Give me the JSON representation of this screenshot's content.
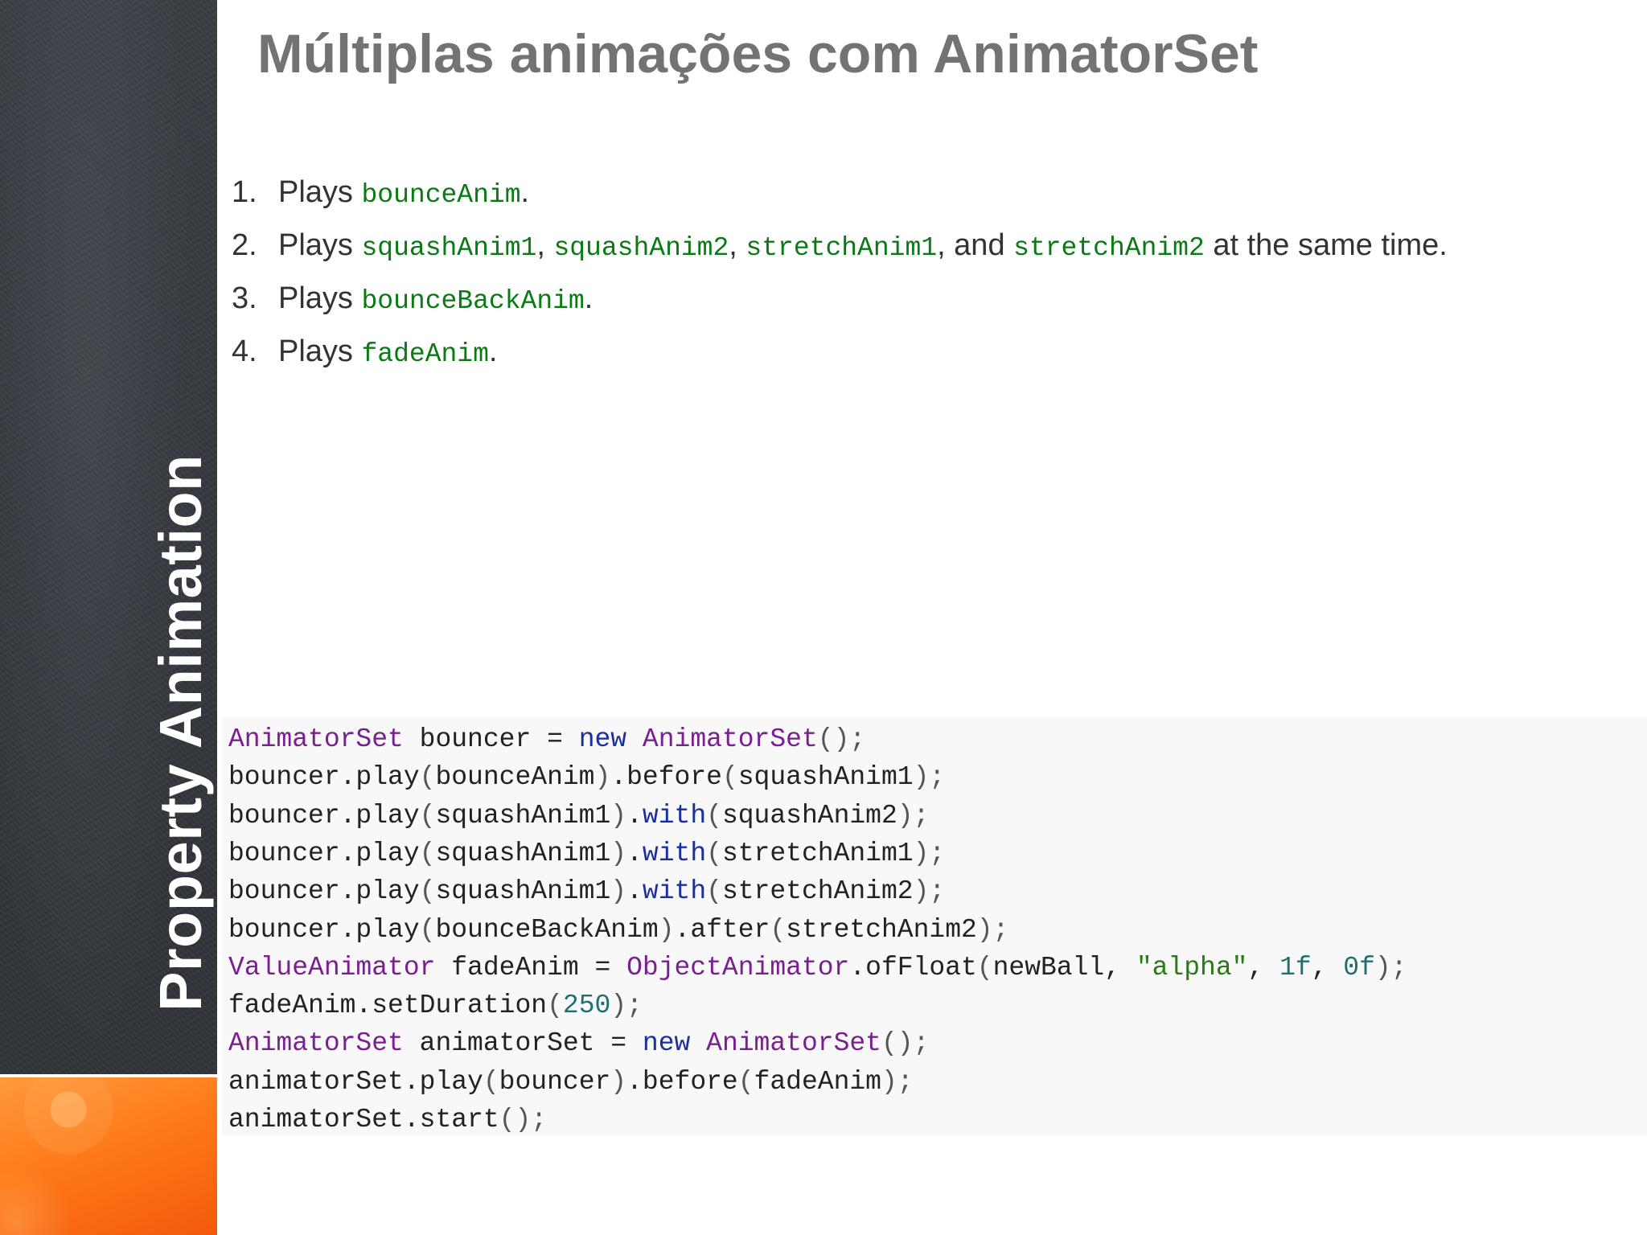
{
  "sidebar": {
    "vertical_title": "Property Animation"
  },
  "slide": {
    "title": "Múltiplas animações com AnimatorSet"
  },
  "steps": [
    {
      "num": "1.",
      "parts": [
        {
          "t": "text",
          "v": "Plays "
        },
        {
          "t": "code",
          "v": "bounceAnim"
        },
        {
          "t": "text",
          "v": "."
        }
      ]
    },
    {
      "num": "2.",
      "parts": [
        {
          "t": "text",
          "v": "Plays "
        },
        {
          "t": "code",
          "v": "squashAnim1"
        },
        {
          "t": "text",
          "v": ", "
        },
        {
          "t": "code",
          "v": "squashAnim2"
        },
        {
          "t": "text",
          "v": ", "
        },
        {
          "t": "code",
          "v": "stretchAnim1"
        },
        {
          "t": "text",
          "v": ", and "
        },
        {
          "t": "code",
          "v": "stretchAnim2"
        },
        {
          "t": "text",
          "v": " at the same time."
        }
      ]
    },
    {
      "num": "3.",
      "parts": [
        {
          "t": "text",
          "v": "Plays "
        },
        {
          "t": "code",
          "v": "bounceBackAnim"
        },
        {
          "t": "text",
          "v": "."
        }
      ]
    },
    {
      "num": "4.",
      "parts": [
        {
          "t": "text",
          "v": "Plays "
        },
        {
          "t": "code",
          "v": "fadeAnim"
        },
        {
          "t": "text",
          "v": "."
        }
      ]
    }
  ],
  "code": [
    [
      {
        "c": "type",
        "v": "AnimatorSet"
      },
      {
        "c": "plain",
        "v": " bouncer = "
      },
      {
        "c": "kw",
        "v": "new"
      },
      {
        "c": "plain",
        "v": " "
      },
      {
        "c": "type",
        "v": "AnimatorSet"
      },
      {
        "c": "pun",
        "v": "();"
      }
    ],
    [
      {
        "c": "plain",
        "v": "bouncer.play"
      },
      {
        "c": "pun",
        "v": "("
      },
      {
        "c": "plain",
        "v": "bounceAnim"
      },
      {
        "c": "pun",
        "v": ")"
      },
      {
        "c": "plain",
        "v": ".before"
      },
      {
        "c": "pun",
        "v": "("
      },
      {
        "c": "plain",
        "v": "squashAnim1"
      },
      {
        "c": "pun",
        "v": ");"
      }
    ],
    [
      {
        "c": "plain",
        "v": "bouncer.play"
      },
      {
        "c": "pun",
        "v": "("
      },
      {
        "c": "plain",
        "v": "squashAnim1"
      },
      {
        "c": "pun",
        "v": ")"
      },
      {
        "c": "plain",
        "v": "."
      },
      {
        "c": "kw",
        "v": "with"
      },
      {
        "c": "pun",
        "v": "("
      },
      {
        "c": "plain",
        "v": "squashAnim2"
      },
      {
        "c": "pun",
        "v": ");"
      }
    ],
    [
      {
        "c": "plain",
        "v": "bouncer.play"
      },
      {
        "c": "pun",
        "v": "("
      },
      {
        "c": "plain",
        "v": "squashAnim1"
      },
      {
        "c": "pun",
        "v": ")"
      },
      {
        "c": "plain",
        "v": "."
      },
      {
        "c": "kw",
        "v": "with"
      },
      {
        "c": "pun",
        "v": "("
      },
      {
        "c": "plain",
        "v": "stretchAnim1"
      },
      {
        "c": "pun",
        "v": ");"
      }
    ],
    [
      {
        "c": "plain",
        "v": "bouncer.play"
      },
      {
        "c": "pun",
        "v": "("
      },
      {
        "c": "plain",
        "v": "squashAnim1"
      },
      {
        "c": "pun",
        "v": ")"
      },
      {
        "c": "plain",
        "v": "."
      },
      {
        "c": "kw",
        "v": "with"
      },
      {
        "c": "pun",
        "v": "("
      },
      {
        "c": "plain",
        "v": "stretchAnim2"
      },
      {
        "c": "pun",
        "v": ");"
      }
    ],
    [
      {
        "c": "plain",
        "v": "bouncer.play"
      },
      {
        "c": "pun",
        "v": "("
      },
      {
        "c": "plain",
        "v": "bounceBackAnim"
      },
      {
        "c": "pun",
        "v": ")"
      },
      {
        "c": "plain",
        "v": ".after"
      },
      {
        "c": "pun",
        "v": "("
      },
      {
        "c": "plain",
        "v": "stretchAnim2"
      },
      {
        "c": "pun",
        "v": ");"
      }
    ],
    [
      {
        "c": "type",
        "v": "ValueAnimator"
      },
      {
        "c": "plain",
        "v": " fadeAnim = "
      },
      {
        "c": "type",
        "v": "ObjectAnimator"
      },
      {
        "c": "plain",
        "v": ".ofFloat"
      },
      {
        "c": "pun",
        "v": "("
      },
      {
        "c": "plain",
        "v": "newBall, "
      },
      {
        "c": "str",
        "v": "\"alpha\""
      },
      {
        "c": "plain",
        "v": ", "
      },
      {
        "c": "num",
        "v": "1f"
      },
      {
        "c": "plain",
        "v": ", "
      },
      {
        "c": "num",
        "v": "0f"
      },
      {
        "c": "pun",
        "v": ");"
      }
    ],
    [
      {
        "c": "plain",
        "v": "fadeAnim.setDuration"
      },
      {
        "c": "pun",
        "v": "("
      },
      {
        "c": "num",
        "v": "250"
      },
      {
        "c": "pun",
        "v": ");"
      }
    ],
    [
      {
        "c": "type",
        "v": "AnimatorSet"
      },
      {
        "c": "plain",
        "v": " animatorSet = "
      },
      {
        "c": "kw",
        "v": "new"
      },
      {
        "c": "plain",
        "v": " "
      },
      {
        "c": "type",
        "v": "AnimatorSet"
      },
      {
        "c": "pun",
        "v": "();"
      }
    ],
    [
      {
        "c": "plain",
        "v": "animatorSet.play"
      },
      {
        "c": "pun",
        "v": "("
      },
      {
        "c": "plain",
        "v": "bouncer"
      },
      {
        "c": "pun",
        "v": ")"
      },
      {
        "c": "plain",
        "v": ".before"
      },
      {
        "c": "pun",
        "v": "("
      },
      {
        "c": "plain",
        "v": "fadeAnim"
      },
      {
        "c": "pun",
        "v": ");"
      }
    ],
    [
      {
        "c": "plain",
        "v": "animatorSet.start"
      },
      {
        "c": "pun",
        "v": "();"
      }
    ]
  ],
  "colors": {
    "sidebar_dark": "#34383e",
    "accent_orange": "#ff7a1a",
    "title_gray": "#737373",
    "code_green": "#0a7a15",
    "code_type": "#7a1f8f",
    "code_keyword": "#1a2ea0"
  }
}
